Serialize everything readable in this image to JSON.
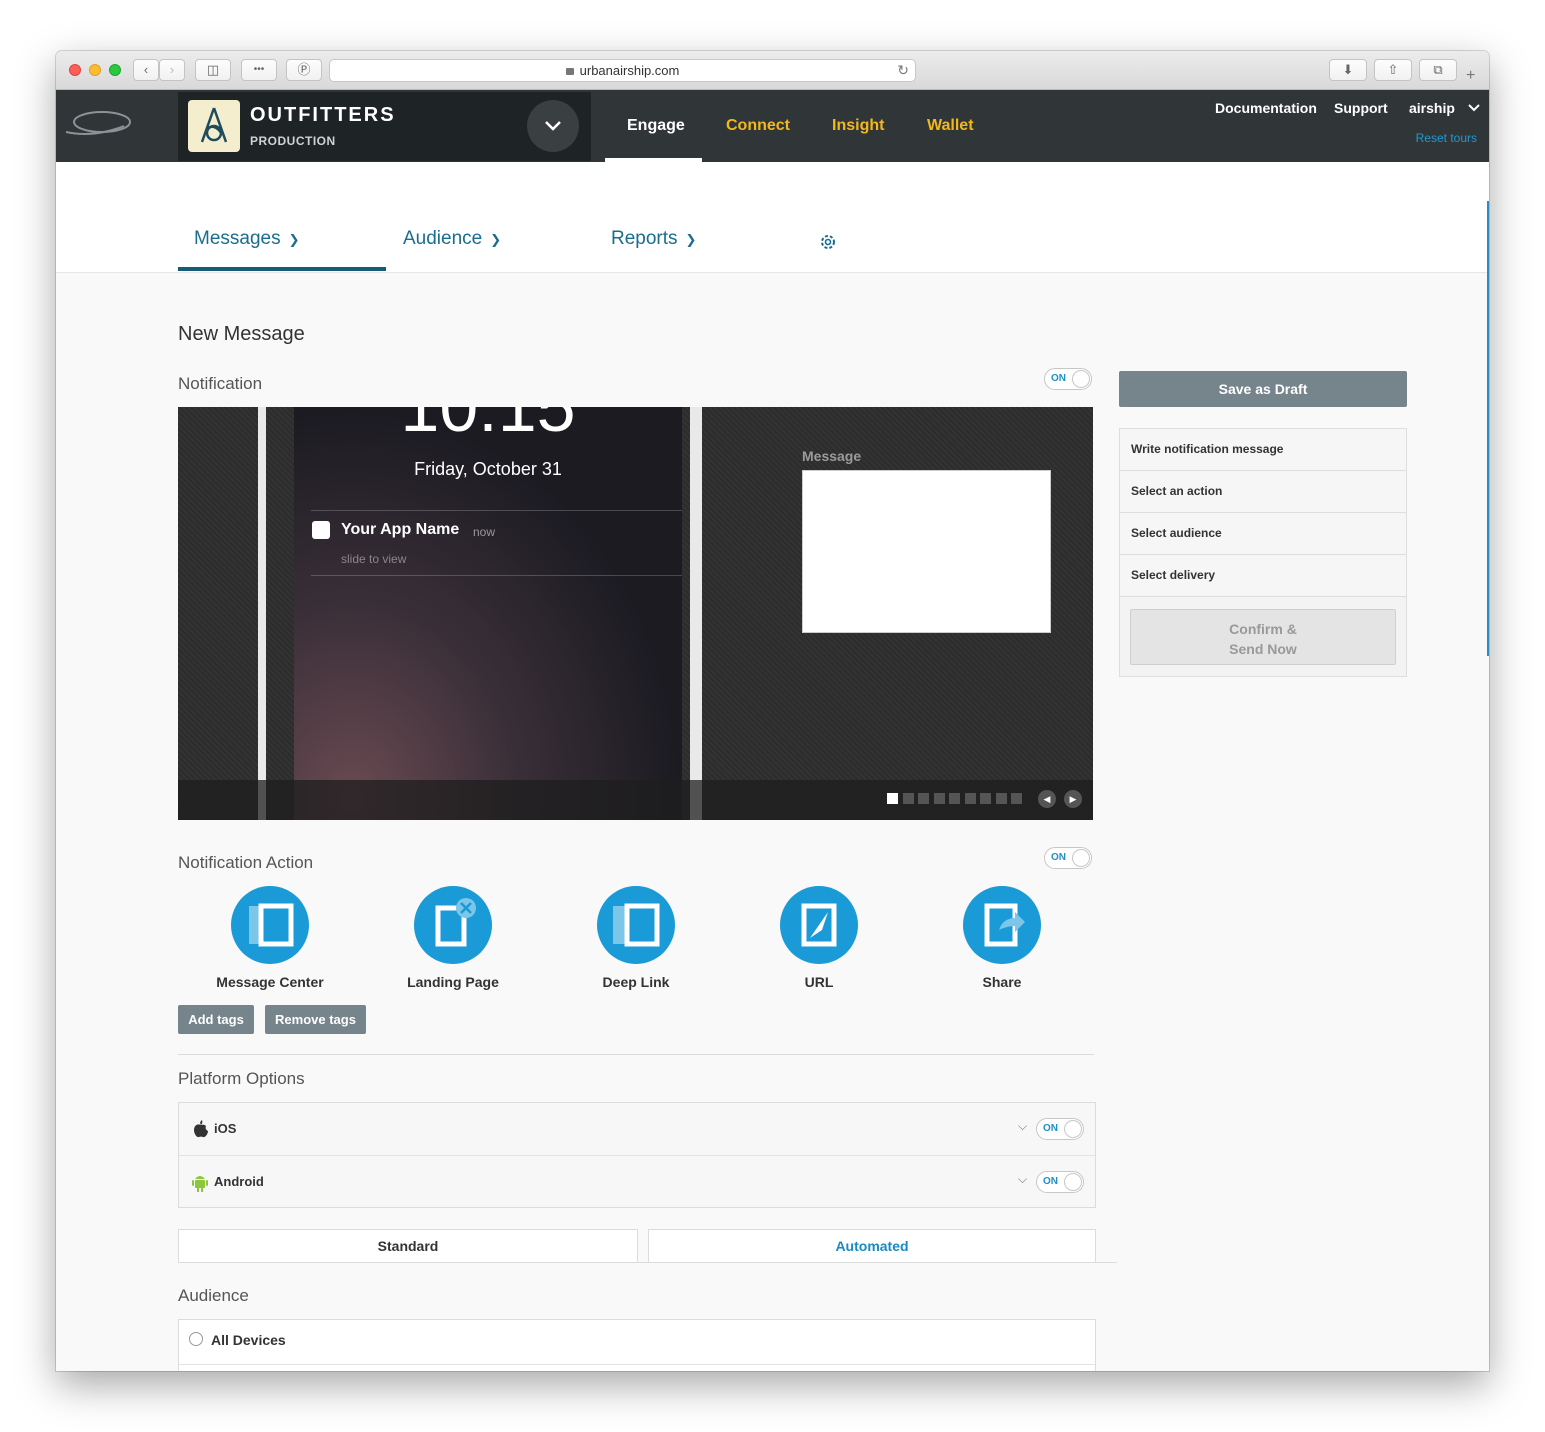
{
  "browser": {
    "url": "urbanairship.com"
  },
  "header": {
    "brand_name": "OUTFITTERS",
    "brand_env": "PRODUCTION",
    "nav": [
      "Engage",
      "Connect",
      "Insight",
      "Wallet"
    ],
    "links": {
      "documentation": "Documentation",
      "support": "Support",
      "user": "airship",
      "reset_tours": "Reset tours"
    },
    "colors": {
      "bar": "#303538",
      "accent": "#f2b81b",
      "link": "#1d9ad6"
    }
  },
  "subnav": {
    "items": [
      "Messages",
      "Audience",
      "Reports"
    ]
  },
  "main": {
    "title": "New Message",
    "notification": {
      "heading": "Notification",
      "toggle": "ON",
      "preview": {
        "date": "Friday, October 31",
        "app_name": "Your App Name",
        "time_ago": "now",
        "slide_text": "slide to view",
        "message_label": "Message"
      }
    },
    "action": {
      "heading": "Notification Action",
      "toggle": "ON",
      "items": [
        "Message Center",
        "Landing Page",
        "Deep Link",
        "URL",
        "Share"
      ],
      "add_tags": "Add tags",
      "remove_tags": "Remove tags"
    },
    "platform": {
      "heading": "Platform Options",
      "ios": "iOS",
      "android": "Android",
      "toggle": "ON"
    },
    "tabs": [
      "Standard",
      "Automated"
    ],
    "audience": {
      "heading": "Audience",
      "all_devices": "All Devices"
    }
  },
  "sidebar": {
    "save_draft": "Save as Draft",
    "steps": [
      "Write notification message",
      "Select an action",
      "Select audience",
      "Select delivery"
    ],
    "confirm_line1": "Confirm &",
    "confirm_line2": "Send Now"
  }
}
